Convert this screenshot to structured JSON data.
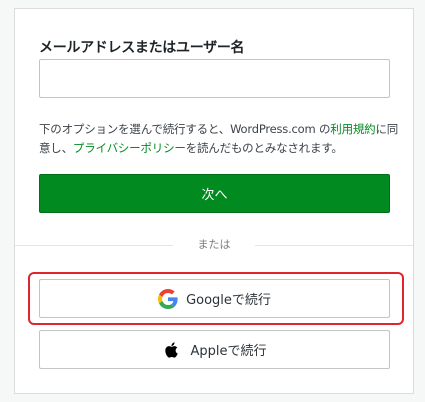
{
  "form": {
    "login_label": "メールアドレスまたはユーザー名",
    "login_value": "",
    "terms": {
      "prefix": "下のオプションを選んで続行すると、WordPress.com の",
      "tos_link": "利用規約",
      "middle": "に同意し、",
      "privacy_link": "プライバシーポリシー",
      "suffix": "を読んだものとみなされます。"
    },
    "next_label": "次へ",
    "divider_label": "または"
  },
  "social": {
    "google_label": "Googleで続行",
    "apple_label": "Appleで続行"
  },
  "colors": {
    "primary": "#008a20",
    "highlight": "#e0252f"
  },
  "icons": {
    "google": "google-icon",
    "apple": "apple-icon"
  }
}
